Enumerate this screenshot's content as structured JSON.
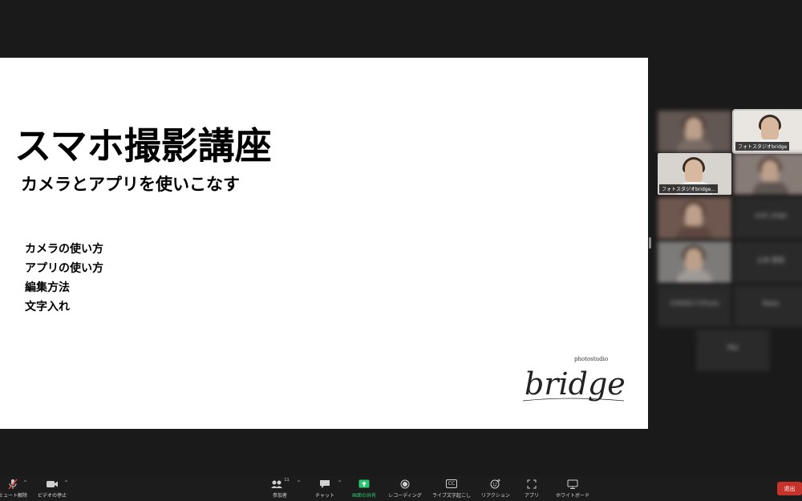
{
  "slide": {
    "title": "スマホ撮影講座",
    "subtitle": "カメラとアプリを使いこなす",
    "items": [
      "カメラの使い方",
      "アプリの使い方",
      "編集方法",
      "文字入れ"
    ],
    "logo_small": "photostudio",
    "logo_main": "bridge"
  },
  "gallery": {
    "tiles": [
      {
        "name": ""
      },
      {
        "name": "フォトスタジオbridge"
      },
      {
        "name": "フォトスタジオbridge..."
      },
      {
        "name": ""
      },
      {
        "name": ""
      },
      {
        "name": "yuki_kage",
        "label": "yuki_kage"
      },
      {
        "name": ""
      },
      {
        "name": "山本 麻美",
        "label": "山本 麻美"
      },
      {
        "name": "CHIEKO F.Photo",
        "label": "CHIEKO F.Photo"
      },
      {
        "name": "Naka",
        "label": "Naka"
      },
      {
        "name": "Mai",
        "label": "Mai"
      }
    ]
  },
  "toolbar": {
    "mute_label": "ミュート解除",
    "video_label": "ビデオの停止",
    "participants_label": "参加者",
    "participants_count": "11",
    "chat_label": "チャット",
    "share_label": "画面の共有",
    "record_label": "レコーディング",
    "caption_label": "ライブ文字起こし",
    "caption_icon_text": "CC",
    "reaction_label": "リアクション",
    "apps_label": "アプリ",
    "whiteboard_label": "ホワイトボード",
    "end_label": "退出",
    "caret": "^"
  },
  "colors": {
    "background": "#1a1a1a",
    "share_green": "#28c76f",
    "end_red": "#c7322b"
  }
}
